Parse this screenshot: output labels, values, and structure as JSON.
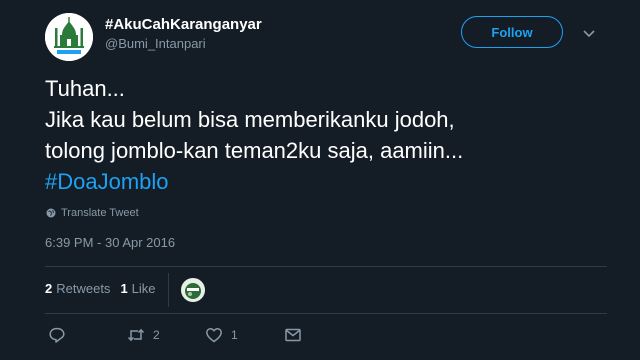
{
  "user": {
    "display_name": "#AkuCahKaranganyar",
    "handle": "@Bumi_Intanpari",
    "avatar_icon": "mosque-logo-icon"
  },
  "follow_label": "Follow",
  "tweet": {
    "lines": [
      "Tuhan...",
      "Jika kau belum bisa memberikanku jodoh,",
      "tolong jomblo-kan teman2ku saja, aamiin..."
    ],
    "hashtag": "#DoaJomblo"
  },
  "translate_label": "Translate Tweet",
  "timestamp": "6:39 PM - 30 Apr 2016",
  "stats": {
    "retweets_count": "2",
    "retweets_label": "Retweets",
    "likes_count": "1",
    "likes_label": "Like"
  },
  "actions": {
    "retweet_count": "2",
    "like_count": "1"
  },
  "colors": {
    "background": "#141d26",
    "accent": "#1da1f2",
    "muted": "#8899a6",
    "divider": "#2f3c47"
  }
}
